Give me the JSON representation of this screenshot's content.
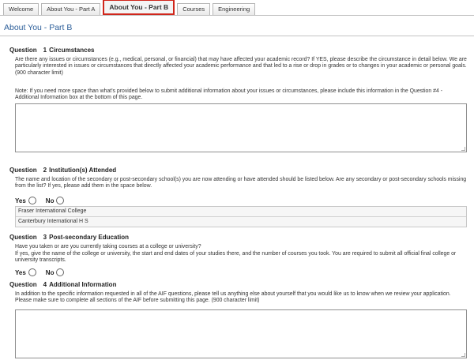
{
  "tabs": [
    "Welcome",
    "About You - Part A",
    "About You - Part B",
    "Courses",
    "Engineering"
  ],
  "active_tab": "About You - Part B",
  "page_title": "About You - Part B",
  "question_label": "Question",
  "questions": [
    {
      "number": "1",
      "title": "Circumstances",
      "text": "Are there any issues or circumstances (e.g., medical, personal, or financial) that may have affected your academic record? If YES, please describe the circumstance in detail below. We are particularly interested in issues or circumstances that directly affected your academic performance and that led to a rise or drop in grades or to changes in your academic or personal goals. (900 character limit)",
      "note": "Note: If you need more space than what's provided below to submit additional information about your issues or circumstances, please include this information in the Question #4 - Additional Information box at the bottom of this page.",
      "answer": ""
    },
    {
      "number": "2",
      "title": "Institution(s) Attended",
      "text": "The name and location of the secondary or post-secondary school(s) you are now attending or have attended should be listed below. Are any secondary or post-secondary schools missing from the list? If yes, please add them in the space below.",
      "schools": [
        "Fraser International College",
        "Canterbury International H S"
      ]
    },
    {
      "number": "3",
      "title": "Post-secondary Education",
      "text": "Have you taken or are you currently taking courses at a college or university?",
      "text2": "If yes, give the name of the college or university, the start and end dates of your studies there, and the number of courses you took. You are required to submit all official final college or university transcripts."
    },
    {
      "number": "4",
      "title": "Additional Information",
      "text": "In addition to the specific information requested in all of the AIF questions, please tell us anything else about yourself that you would like us to know when we review your application. Please make sure to complete all sections of the AIF before submitting this page. (900 character limit)",
      "answer": ""
    }
  ],
  "yes_label": "Yes",
  "no_label": "No"
}
